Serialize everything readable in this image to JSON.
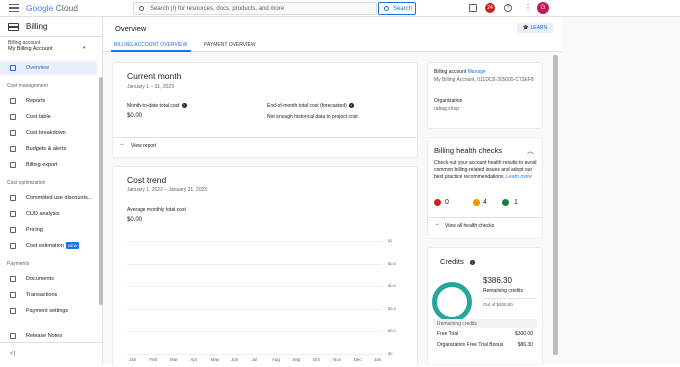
{
  "topbar": {
    "logo_google": "Google",
    "logo_cloud": "Cloud",
    "search_placeholder": "Search (/) for resources, docs, products, and more",
    "search_button": "Search",
    "notification_count": "24",
    "avatar_initial": "G"
  },
  "sidebar": {
    "title": "Billing",
    "account_label": "Billing account",
    "account_value": "My Billing Account",
    "overview": "Overview",
    "section_cost_management": "Cost management",
    "reports": "Reports",
    "cost_table": "Cost table",
    "cost_breakdown": "Cost breakdown",
    "budgets_alerts": "Budgets & alerts",
    "billing_export": "Billing export",
    "section_cost_optimization": "Cost optimization",
    "committed_use": "Committed use discounts...",
    "cud_analysis": "CUD analysis",
    "pricing": "Pricing",
    "cost_estimation": "Cost estimation",
    "new_badge": "NEW",
    "section_payments": "Payments",
    "documents": "Documents",
    "transactions": "Transactions",
    "payment_settings": "Payment settings",
    "release_notes": "Release Notes",
    "collapse": "<|"
  },
  "main": {
    "title": "Overview",
    "learn": "LEARN",
    "tabs": [
      "BILLING ACCOUNT OVERVIEW",
      "PAYMENT OVERVIEW"
    ]
  },
  "current_month": {
    "title": "Current month",
    "range": "January 1 – 31, 2023",
    "mtd_label": "Month-to-date total cost",
    "mtd_value": "$0.00",
    "eom_label": "End-of-month total cost (forecasted)",
    "eom_value": "Not enough historical data to project cost",
    "view_report": "View report"
  },
  "cost_trend": {
    "title": "Cost trend",
    "range": "January 1, 2022 – January 31, 2023",
    "avg_label": "Average monthly total cost",
    "avg_value": "$0.00"
  },
  "chart_data": {
    "type": "bar",
    "categories": [
      "Jan",
      "Feb",
      "Mar",
      "Apr",
      "May",
      "Jun",
      "Jul",
      "Aug",
      "Sep",
      "Oct",
      "Nov",
      "Dec",
      "Jan"
    ],
    "values": [
      0,
      0,
      0,
      0,
      0,
      0,
      0,
      0,
      0,
      0,
      0,
      0,
      0
    ],
    "yticks": [
      "$1",
      "$0.8",
      "$0.6",
      "$0.4",
      "$0.2",
      "$0"
    ],
    "ylim": [
      0,
      1
    ],
    "grid": true
  },
  "account_card": {
    "label": "Billing account",
    "manage": "Manage",
    "account_name": "My Billing Account, 011DC8-305095-C73EF8",
    "org_label": "Organization",
    "org_value": "rabag.shop"
  },
  "health": {
    "title": "Billing health checks",
    "desc": "Check out your account health results to avoid common billing-related issues and adopt our best practice recommendations.",
    "learn_more": "Learn more",
    "red": "0",
    "orange": "4",
    "green": "1",
    "view_all": "View all health checks",
    "colors": {
      "red": "#c5221f",
      "orange": "#f29900",
      "green": "#188038"
    }
  },
  "credits": {
    "title": "Credits",
    "amount": "$386.30",
    "remaining_label": "Remaining credits",
    "out_of": "Out of $400.00",
    "remaining_fraction": 0.966,
    "table_header": "Remaining credits",
    "rows": [
      {
        "name": "Free Trial",
        "value": "$300.00"
      },
      {
        "name": "Organization Free Trial Bonus",
        "value": "$86.30"
      }
    ]
  }
}
